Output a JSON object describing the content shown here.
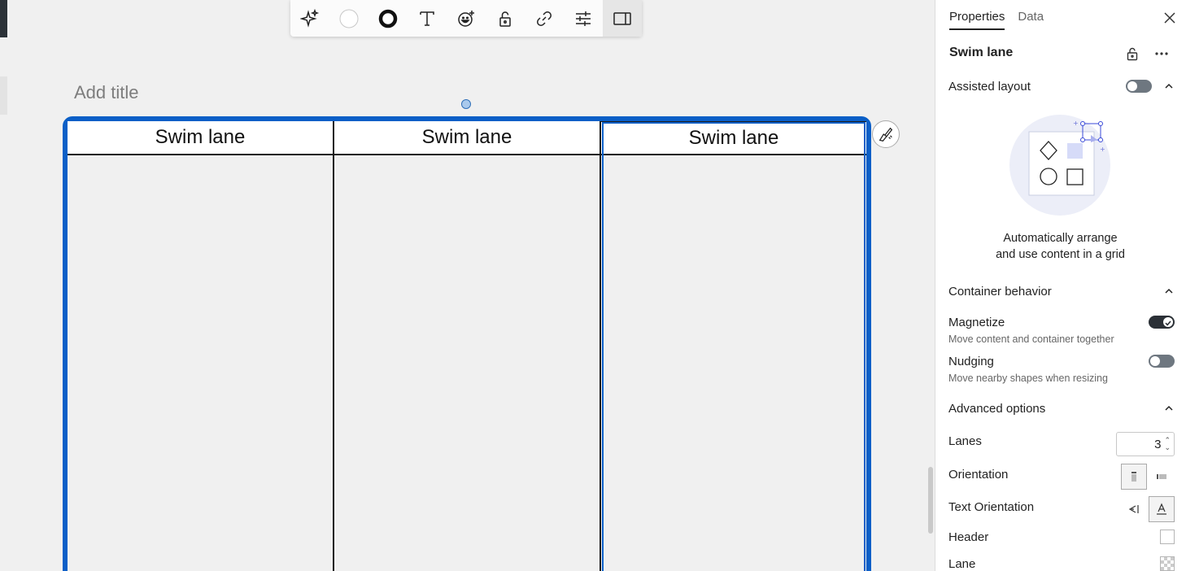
{
  "canvas": {
    "add_title_placeholder": "Add title",
    "swimlane": {
      "lanes": [
        {
          "header": "Swim lane"
        },
        {
          "header": "Swim lane"
        },
        {
          "header": "Swim lane"
        }
      ],
      "border_color": "#0a5fc7"
    }
  },
  "toolbar": {
    "items": [
      "sparkle-icon",
      "fill-color-icon",
      "border-style-icon",
      "text-icon",
      "emoji-add-icon",
      "lock-icon",
      "link-icon",
      "sliders-icon",
      "panel-toggle-icon"
    ],
    "active": "panel-toggle-icon"
  },
  "panel": {
    "tabs": [
      {
        "label": "Properties",
        "active": true
      },
      {
        "label": "Data",
        "active": false
      }
    ],
    "shape_name": "Swim lane",
    "assisted_layout": {
      "label": "Assisted layout",
      "enabled": false,
      "caption_line1": "Automatically arrange",
      "caption_line2": "and use content in a grid"
    },
    "container_behavior": {
      "label": "Container behavior",
      "magnetize": {
        "label": "Magnetize",
        "description": "Move content and container together",
        "enabled": true
      },
      "nudging": {
        "label": "Nudging",
        "description": "Move nearby shapes when resizing",
        "enabled": false
      }
    },
    "advanced_options": {
      "label": "Advanced options",
      "lanes": {
        "label": "Lanes",
        "value": "3"
      },
      "orientation": {
        "label": "Orientation",
        "selected": "vertical"
      },
      "text_orientation": {
        "label": "Text Orientation",
        "selected": "horizontal"
      },
      "header": {
        "label": "Header"
      },
      "lane": {
        "label": "Lane"
      }
    }
  }
}
